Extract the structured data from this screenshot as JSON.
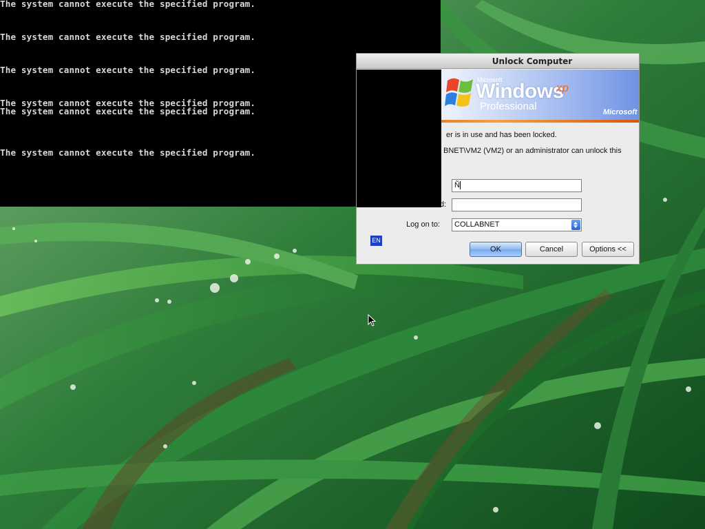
{
  "console": {
    "lines": [
      "The system cannot execute the specified program.",
      "The system cannot execute the specified program.",
      "The system cannot execute the specified program.",
      "The system cannot execute the specified program.",
      "The system cannot execute the specified program.",
      "The system cannot execute the specified program."
    ]
  },
  "dialog": {
    "title": "Unlock Computer",
    "banner": {
      "maker_small": "Microsoft",
      "product": "Windows",
      "version": "xp",
      "edition": "Professional",
      "brand": "Microsoft"
    },
    "message_line1": "er is in use and has been locked.",
    "message_line2": "BNET\\VM2 (VM2) or an administrator can unlock this",
    "username_value": "Ñ",
    "password_label": "Password:",
    "password_value": "",
    "logon_label": "Log on to:",
    "logon_value": "COLLABNET",
    "language_indicator": "EN",
    "buttons": {
      "ok": "OK",
      "cancel": "Cancel",
      "options": "Options <<"
    }
  },
  "colors": {
    "console_bg": "#000000",
    "console_text": "#d8d8d8",
    "dialog_bg": "#ececec",
    "default_button": "#79aaee",
    "language_badge": "#1e3fbf"
  }
}
